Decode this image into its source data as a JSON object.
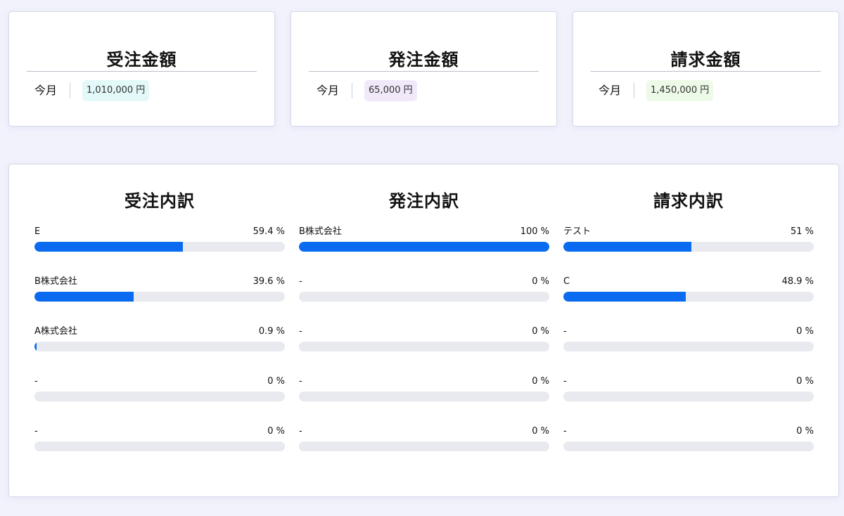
{
  "summary": [
    {
      "title": "受注金額",
      "period": "今月",
      "amount": "1,010,000 円",
      "badge_color": "#e3f8f8"
    },
    {
      "title": "発注金額",
      "period": "今月",
      "amount": "65,000 円",
      "badge_color": "#f1e8fa"
    },
    {
      "title": "請求金額",
      "period": "今月",
      "amount": "1,450,000 円",
      "badge_color": "#eefae8"
    }
  ],
  "breakdown": [
    {
      "title": "受注内訳",
      "items": [
        {
          "label": "E",
          "pct_text": "59.4 %",
          "value": 59.4
        },
        {
          "label": "B株式会社",
          "pct_text": "39.6 %",
          "value": 39.6
        },
        {
          "label": "A株式会社",
          "pct_text": "0.9 %",
          "value": 0.9
        },
        {
          "label": "-",
          "pct_text": "0 %",
          "value": 0
        },
        {
          "label": "-",
          "pct_text": "0 %",
          "value": 0
        }
      ]
    },
    {
      "title": "発注内訳",
      "items": [
        {
          "label": "B株式会社",
          "pct_text": "100 %",
          "value": 100
        },
        {
          "label": "-",
          "pct_text": "0 %",
          "value": 0
        },
        {
          "label": "-",
          "pct_text": "0 %",
          "value": 0
        },
        {
          "label": "-",
          "pct_text": "0 %",
          "value": 0
        },
        {
          "label": "-",
          "pct_text": "0 %",
          "value": 0
        }
      ]
    },
    {
      "title": "請求内訳",
      "items": [
        {
          "label": "テスト",
          "pct_text": "51 %",
          "value": 51
        },
        {
          "label": "C",
          "pct_text": "48.9 %",
          "value": 48.9
        },
        {
          "label": "-",
          "pct_text": "0 %",
          "value": 0
        },
        {
          "label": "-",
          "pct_text": "0 %",
          "value": 0
        },
        {
          "label": "-",
          "pct_text": "0 %",
          "value": 0
        }
      ]
    }
  ],
  "colors": {
    "bar_fill": "#0a6bf0",
    "bar_track": "#e9eaef"
  }
}
